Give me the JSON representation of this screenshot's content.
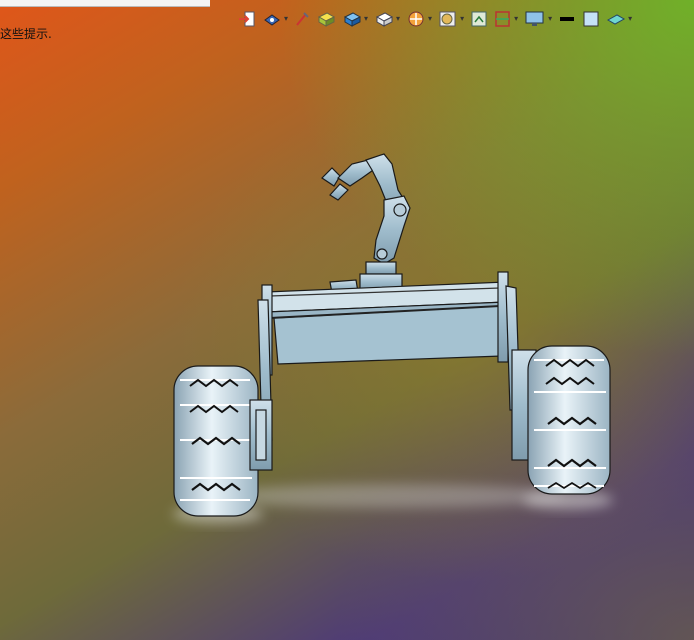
{
  "hint": {
    "text": "这些提示."
  },
  "toolbar": {
    "items": [
      {
        "name": "exit-sketch",
        "dropdown": false
      },
      {
        "name": "view-orientation",
        "dropdown": true
      },
      {
        "name": "section-view",
        "dropdown": false
      },
      {
        "name": "display-style-shaded",
        "dropdown": false
      },
      {
        "name": "view-cube",
        "dropdown": true
      },
      {
        "name": "hide-show-items",
        "dropdown": true
      },
      {
        "name": "edit-appearance",
        "dropdown": true
      },
      {
        "name": "apply-scene",
        "dropdown": true
      },
      {
        "name": "view-settings",
        "dropdown": false
      },
      {
        "name": "zoom-section",
        "dropdown": true
      },
      {
        "name": "monitor-display",
        "dropdown": true
      },
      {
        "name": "line-style",
        "dropdown": false
      },
      {
        "name": "color-swatch",
        "dropdown": false
      },
      {
        "name": "plane-display",
        "dropdown": true
      }
    ],
    "caret": "▾"
  },
  "colors": {
    "background_top_left": "#e0561a",
    "background_top_right": "#6eb428",
    "background_bottom_left": "#40307a",
    "model_fill": "#a9c3d4",
    "model_edge": "#1a1a1a"
  }
}
